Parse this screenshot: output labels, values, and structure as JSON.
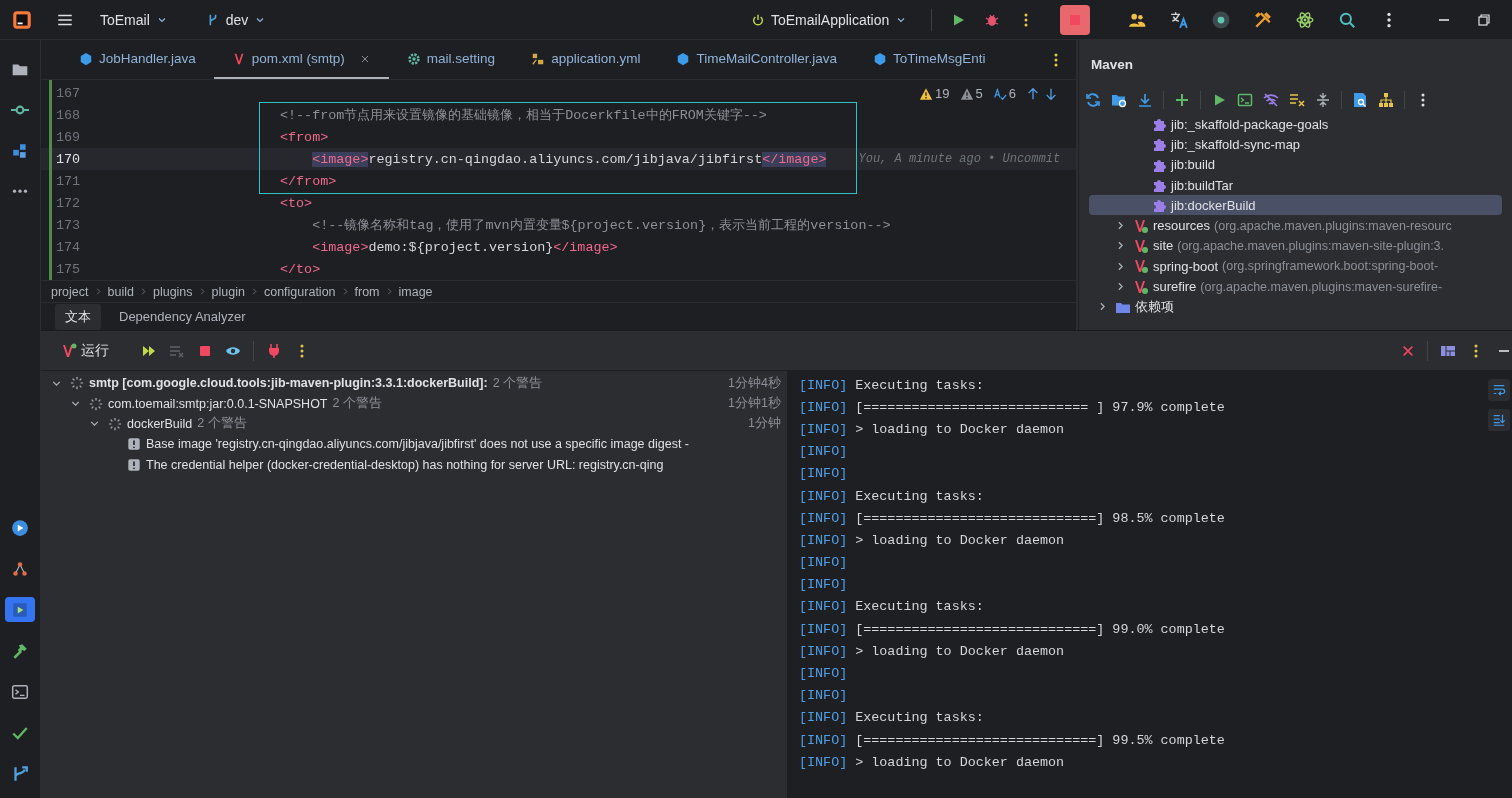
{
  "title_bar": {
    "project": "ToEmail",
    "branch": "dev",
    "run_config": "ToEmailApplication"
  },
  "tool_windows": {
    "top": [
      {
        "kind": "project",
        "selected": false
      },
      {
        "kind": "commit",
        "selected": false
      },
      {
        "kind": "structure",
        "selected": false
      },
      {
        "kind": "more",
        "selected": false
      }
    ],
    "bottom": [
      {
        "kind": "services",
        "selected": false
      },
      {
        "kind": "graph",
        "selected": false
      },
      {
        "kind": "run",
        "selected": true
      },
      {
        "kind": "build",
        "selected": false
      },
      {
        "kind": "terminal",
        "selected": false
      },
      {
        "kind": "problems",
        "selected": false
      },
      {
        "kind": "git",
        "selected": false
      }
    ]
  },
  "editor": {
    "tabs": [
      {
        "kind": "java",
        "label": "JobHandler.java",
        "selected": false
      },
      {
        "kind": "maven",
        "label": "pom.xml (smtp)",
        "selected": true
      },
      {
        "kind": "settings",
        "label": "mail.setting",
        "selected": false
      },
      {
        "kind": "yaml",
        "label": "application.yml",
        "selected": false
      },
      {
        "kind": "java",
        "label": "TimeMailController.java",
        "selected": false
      },
      {
        "kind": "java",
        "label": "ToTimeMsgEnti",
        "selected": false
      }
    ],
    "inspections": [
      {
        "kind": "warning",
        "count": "19"
      },
      {
        "kind": "weak",
        "count": "5"
      },
      {
        "kind": "typo",
        "count": "6"
      }
    ],
    "lines": [
      {
        "number": "167",
        "current": false,
        "boxed": false
      },
      {
        "number": "168",
        "current": false,
        "boxed": true,
        "segments": [
          {
            "kind": "comment",
            "text": "<!--from节点用来设置镜像的基础镜像，相当于Docerkfile中的FROM关键字-->"
          }
        ]
      },
      {
        "number": "169",
        "current": false,
        "boxed": true,
        "segments": [
          {
            "kind": "tag",
            "text": "<from>"
          }
        ],
        "children": [
          {
            "number": "170",
            "current": true,
            "boxed": true,
            "segments": [
              {
                "kind": "match",
                "text": "<image>"
              },
              {
                "kind": "text",
                "text": "registry.cn-qingdao.aliyuncs.com/jibjava/jibfirst"
              },
              {
                "kind": "match",
                "text": "</image>"
              },
              {
                "kind": "hint",
                "text": "You, A minute ago • Uncommit"
              }
            ]
          }
        ]
      },
      {
        "number": "171",
        "current": false,
        "boxed": true,
        "segments": [
          {
            "kind": "tag",
            "text": "</from>"
          }
        ]
      },
      {
        "number": "172",
        "current": false,
        "boxed": false,
        "segments": [
          {
            "kind": "tag",
            "text": "<to>"
          }
        ],
        "children": [
          {
            "number": "173",
            "current": false,
            "boxed": false,
            "segments": [
              {
                "kind": "comment",
                "text": "<!--镜像名称和tag，使用了mvn内置变量${project.version}，表示当前工程的version-->"
              }
            ]
          },
          {
            "number": "174",
            "current": false,
            "boxed": false,
            "segments": [
              {
                "kind": "tag",
                "text": "<image>"
              },
              {
                "kind": "text",
                "text": "demo:${project.version}"
              },
              {
                "kind": "tag",
                "text": "</image>"
              }
            ]
          }
        ]
      },
      {
        "number": "175",
        "current": false,
        "boxed": false,
        "segments": [
          {
            "kind": "tag",
            "text": "</to>"
          }
        ]
      }
    ],
    "breadcrumb": [
      "project",
      "build",
      "plugins",
      "plugin",
      "configuration",
      "from",
      "image"
    ],
    "bottom_tabs": [
      {
        "label": "文本",
        "selected": true
      },
      {
        "label": "Dependency Analyzer",
        "selected": false
      }
    ]
  },
  "maven": {
    "title": "Maven",
    "tree": [
      {
        "children": [
          {
            "children": [
              {
                "kind": "goal",
                "label": "jib:_skaffold-package-goals",
                "selected": false
              },
              {
                "kind": "goal",
                "label": "jib:_skaffold-sync-map",
                "selected": false
              },
              {
                "kind": "goal",
                "label": "jib:build",
                "selected": false
              },
              {
                "kind": "goal",
                "label": "jib:buildTar",
                "selected": false
              },
              {
                "kind": "goal",
                "label": "jib:dockerBuild",
                "selected": true
              }
            ]
          },
          {
            "kind": "plugin",
            "label": "resources",
            "detail": "(org.apache.maven.plugins:maven-resourc",
            "expanded": false,
            "selected": false
          },
          {
            "kind": "plugin",
            "label": "site",
            "detail": "(org.apache.maven.plugins:maven-site-plugin:3.",
            "expanded": false,
            "selected": false
          },
          {
            "kind": "plugin",
            "label": "spring-boot",
            "detail": "(org.springframework.boot:spring-boot-",
            "expanded": false,
            "selected": false
          },
          {
            "kind": "plugin",
            "label": "surefire",
            "detail": "(org.apache.maven.plugins:maven-surefire-",
            "expanded": false,
            "selected": false
          }
        ]
      },
      {
        "kind": "folder",
        "label": "依赖项",
        "expanded": false,
        "selected": false
      }
    ]
  },
  "run": {
    "tab": "运行",
    "tree": [
      {
        "kind": "task",
        "label": "smtp [com.google.cloud.tools:jib-maven-plugin:3.3.1:dockerBuild]:",
        "count": "2 个警告",
        "time": "1分钟4秒",
        "expanded": true,
        "children": [
          {
            "kind": "task",
            "label": "com.toemail:smtp:jar:0.0.1-SNAPSHOT",
            "count": "2 个警告",
            "time": "1分钟1秒",
            "expanded": true,
            "children": [
              {
                "kind": "task",
                "label": "dockerBuild",
                "count": "2 个警告",
                "time": "1分钟",
                "expanded": true,
                "children": [
                  {
                    "kind": "warning",
                    "label": "Base image 'registry.cn-qingdao.aliyuncs.com/jibjava/jibfirst' does not use a specific image digest -"
                  },
                  {
                    "kind": "warning",
                    "label": "The credential helper (docker-credential-desktop) has nothing for server URL: registry.cn-qing"
                  }
                ]
              }
            ]
          }
        ]
      }
    ],
    "console": [
      {
        "tag": "[INFO]",
        "text": "Executing tasks:"
      },
      {
        "tag": "[INFO]",
        "text": "[============================ ] 97.9% complete"
      },
      {
        "tag": "[INFO]",
        "text": "> loading to Docker daemon"
      },
      {
        "tag": "[INFO]"
      },
      {
        "tag": "[INFO]"
      },
      {
        "tag": "[INFO]",
        "text": "Executing tasks:"
      },
      {
        "tag": "[INFO]",
        "text": "[=============================] 98.5% complete"
      },
      {
        "tag": "[INFO]",
        "text": "> loading to Docker daemon"
      },
      {
        "tag": "[INFO]"
      },
      {
        "tag": "[INFO]"
      },
      {
        "tag": "[INFO]",
        "text": "Executing tasks:"
      },
      {
        "tag": "[INFO]",
        "text": "[=============================] 99.0% complete"
      },
      {
        "tag": "[INFO]",
        "text": "> loading to Docker daemon"
      },
      {
        "tag": "[INFO]"
      },
      {
        "tag": "[INFO]"
      },
      {
        "tag": "[INFO]",
        "text": "Executing tasks:"
      },
      {
        "tag": "[INFO]",
        "text": "[=============================] 99.5% complete"
      },
      {
        "tag": "[INFO]",
        "text": "> loading to Docker daemon"
      }
    ]
  }
}
